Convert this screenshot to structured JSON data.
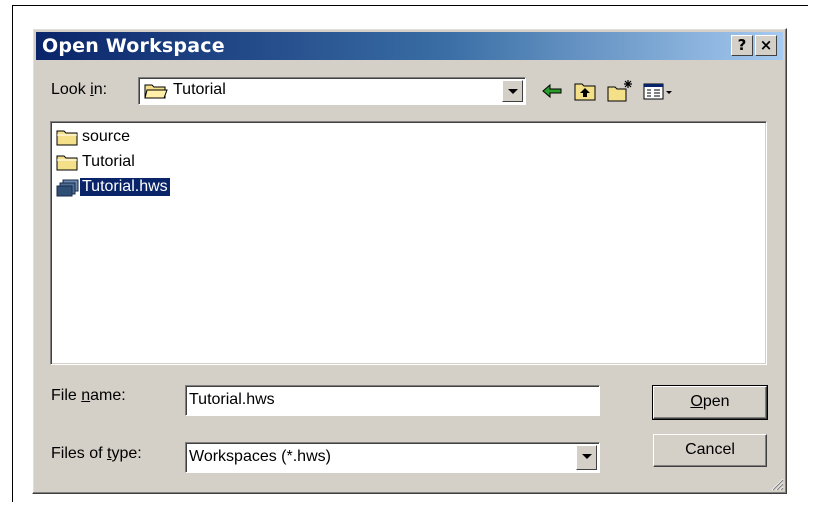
{
  "dialog": {
    "title": "Open Workspace",
    "help_button": "?",
    "close_button": "×"
  },
  "look_in": {
    "label_pre": "Look ",
    "label_mnemonic": "i",
    "label_post": "n:",
    "value": "Tutorial"
  },
  "toolbar": {
    "icons": [
      "back-arrow-icon",
      "up-one-level-icon",
      "new-folder-icon",
      "view-menu-icon"
    ]
  },
  "files": [
    {
      "name": "source",
      "type": "folder",
      "selected": false
    },
    {
      "name": "Tutorial",
      "type": "folder",
      "selected": false
    },
    {
      "name": "Tutorial.hws",
      "type": "workspace",
      "selected": true
    }
  ],
  "file_name": {
    "label_pre": "File ",
    "label_mnemonic": "n",
    "label_post": "ame:",
    "value": "Tutorial.hws"
  },
  "file_type": {
    "label_pre": "Files of ",
    "label_mnemonic": "t",
    "label_post": "ype:",
    "value": "Workspaces (*.hws)"
  },
  "buttons": {
    "open_mnemonic": "O",
    "open_rest": "pen",
    "cancel": "Cancel"
  },
  "colors": {
    "titlebar_start": "#0a246a",
    "titlebar_end": "#a6caf0",
    "face": "#d4d0c8",
    "selection": "#0a246a"
  }
}
